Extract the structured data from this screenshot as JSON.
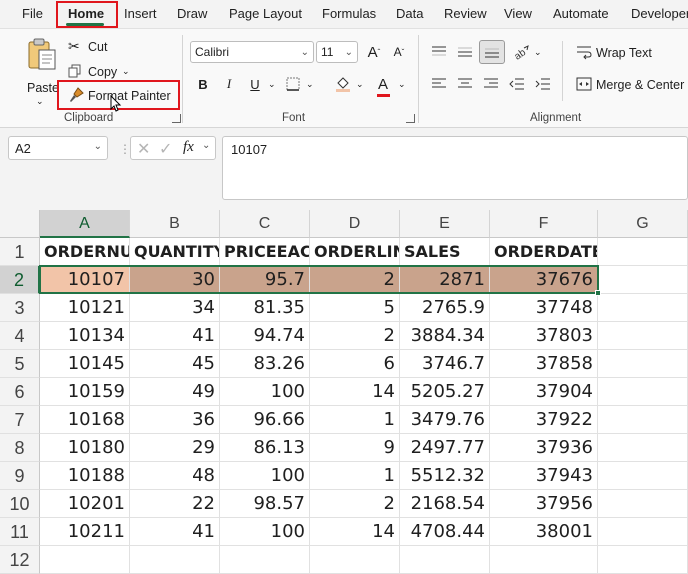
{
  "menu": {
    "tabs": [
      {
        "label": "File"
      },
      {
        "label": "Home"
      },
      {
        "label": "Insert"
      },
      {
        "label": "Draw"
      },
      {
        "label": "Page Layout"
      },
      {
        "label": "Formulas"
      },
      {
        "label": "Data"
      },
      {
        "label": "Review"
      },
      {
        "label": "View"
      },
      {
        "label": "Automate"
      },
      {
        "label": "Developer"
      }
    ],
    "active_tab": "Home"
  },
  "ribbon": {
    "clipboard": {
      "paste_label": "Paste",
      "cut_label": "Cut",
      "copy_label": "Copy",
      "format_painter_label": "Format Painter",
      "group_label": "Clipboard"
    },
    "font": {
      "font_name": "Calibri",
      "font_size": "11",
      "bold_label": "B",
      "italic_label": "I",
      "underline_label": "U",
      "font_color_label": "A",
      "grow_label": "A",
      "shrink_label": "A",
      "group_label": "Font",
      "font_color": "#e0161d"
    },
    "alignment": {
      "wrap_text_label": "Wrap Text",
      "merge_center_label": "Merge & Center",
      "group_label": "Alignment"
    }
  },
  "formula_bar": {
    "name_box": "A2",
    "fx_label": "fx",
    "formula_value": "10107"
  },
  "sheet": {
    "columns": [
      "A",
      "B",
      "C",
      "D",
      "E",
      "F",
      "G"
    ],
    "rows": [
      "1",
      "2",
      "3",
      "4",
      "5",
      "6",
      "7",
      "8",
      "9",
      "10",
      "11",
      "12"
    ],
    "headers": [
      "ORDERNUMBER",
      "QUANTITYORDERED",
      "PRICEEACH",
      "ORDERLINENUMBER",
      "SALES",
      "ORDERDATE"
    ],
    "data": [
      [
        "10107",
        "30",
        "95.7",
        "2",
        "2871",
        "37676"
      ],
      [
        "10121",
        "34",
        "81.35",
        "5",
        "2765.9",
        "37748"
      ],
      [
        "10134",
        "41",
        "94.74",
        "2",
        "3884.34",
        "37803"
      ],
      [
        "10145",
        "45",
        "83.26",
        "6",
        "3746.7",
        "37858"
      ],
      [
        "10159",
        "49",
        "100",
        "14",
        "5205.27",
        "37904"
      ],
      [
        "10168",
        "36",
        "96.66",
        "1",
        "3479.76",
        "37922"
      ],
      [
        "10180",
        "29",
        "86.13",
        "9",
        "2497.77",
        "37936"
      ],
      [
        "10188",
        "48",
        "100",
        "1",
        "5512.32",
        "37943"
      ],
      [
        "10201",
        "22",
        "98.57",
        "2",
        "2168.54",
        "37956"
      ],
      [
        "10211",
        "41",
        "100",
        "14",
        "4708.44",
        "38001"
      ]
    ],
    "selected_cell": "A2",
    "highlight_color": "#c9a38c",
    "selection_color": "#217346"
  }
}
